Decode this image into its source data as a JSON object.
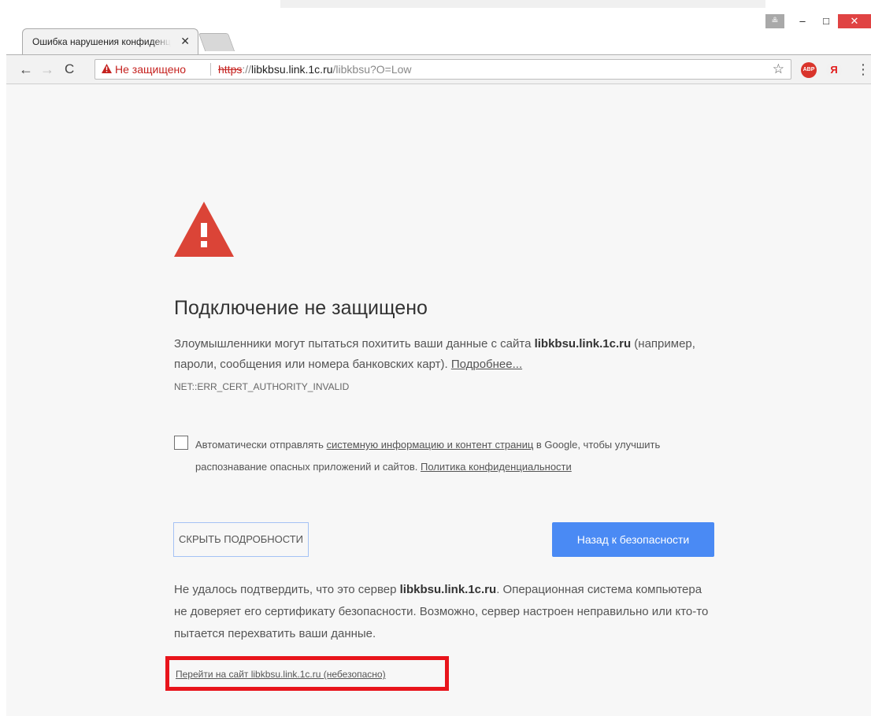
{
  "browser": {
    "tab": {
      "title": "Ошибка нарушения конфиденциальности",
      "close_glyph": "✕"
    },
    "window_controls": {
      "minimize": "–",
      "maximize": "□",
      "close": "✕",
      "profile": "≗"
    },
    "toolbar": {
      "back": "←",
      "forward": "→",
      "reload": "C",
      "security_label": "Не защищено",
      "url_scheme": "https",
      "url_sep": "://",
      "url_host": "libkbsu.link.1c.ru",
      "url_path": "/libkbsu?O=Low",
      "bookmark_star": "☆",
      "abp_label": "ABP",
      "yandex_label": "Я",
      "menu": "⋮"
    }
  },
  "interstitial": {
    "heading": "Подключение не защищено",
    "p1_pre": "Злоумышленники могут пытаться похитить ваши данные с сайта ",
    "p1_host": "libkbsu.link.1c.ru",
    "p1_post": " (например, пароли, сообщения или номера банковских карт). ",
    "learn_more": "Подробнее...",
    "error_code": "NET::ERR_CERT_AUTHORITY_INVALID",
    "checkbox_pre": "Автоматически отправлять ",
    "checkbox_link": "системную информацию и контент страниц",
    "checkbox_mid": " в Google, чтобы улучшить распознавание опасных приложений и сайтов. ",
    "privacy_link": "Политика конфиденциальности",
    "details_button": "СКРЫТЬ ПОДРОБНОСТИ",
    "back_button": "Назад к безопасности",
    "p2_pre": "Не удалось подтвердить, что это сервер ",
    "p2_host": "libkbsu.link.1c.ru",
    "p2_post": ". Операционная система компьютера не доверяет его сертификату безопасности. Возможно, сервер настроен неправильно или кто-то пытается перехватить ваши данные.",
    "proceed_link": "Перейти на сайт libkbsu.link.1c.ru (небезопасно)"
  },
  "colors": {
    "warning_red": "#db4437",
    "highlight_red": "#e8141b",
    "primary_blue": "#4a8af4",
    "insecure_red": "#c5221f"
  }
}
